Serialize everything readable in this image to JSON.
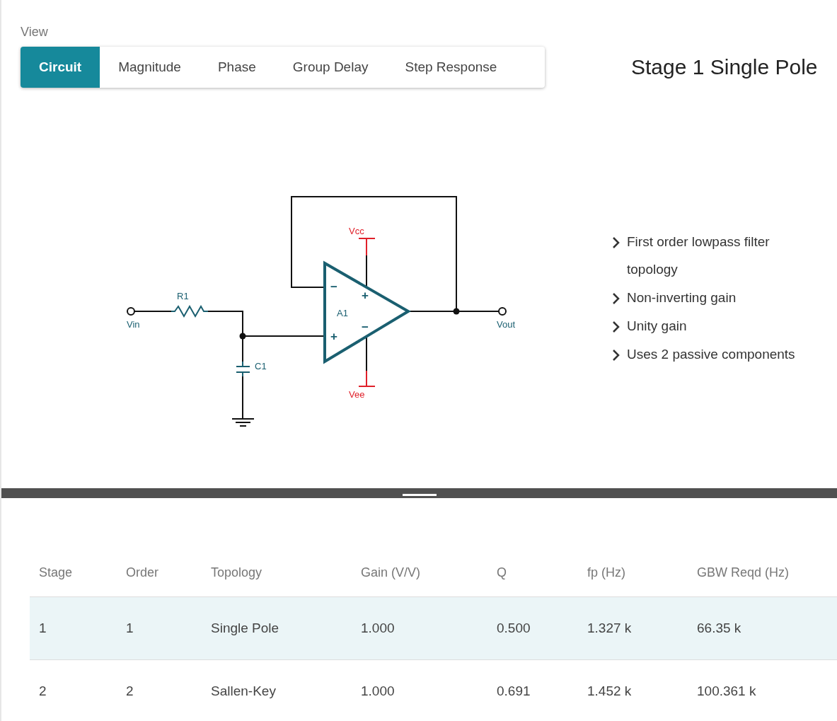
{
  "view_label": "View",
  "tabs": [
    {
      "label": "Circuit",
      "selected": true
    },
    {
      "label": "Magnitude",
      "selected": false
    },
    {
      "label": "Phase",
      "selected": false
    },
    {
      "label": "Group Delay",
      "selected": false
    },
    {
      "label": "Step Response",
      "selected": false
    }
  ],
  "circuit": {
    "input": "Vin",
    "output": "Vout",
    "resistor": "R1",
    "capacitor": "C1",
    "amplifier": "A1",
    "supply_positive": "Vcc",
    "supply_negative": "Vee",
    "input_signs": [
      "−",
      "+"
    ],
    "supply_signs": [
      "+",
      "−"
    ]
  },
  "stage_title": "Stage 1 Single Pole",
  "features": [
    "First order lowpass filter topology",
    "Non-inverting gain",
    "Unity gain",
    "Uses 2 passive components"
  ],
  "table": {
    "columns": [
      "Stage",
      "Order",
      "Topology",
      "Gain (V/V)",
      "Q",
      "fp (Hz)",
      "GBW Reqd (Hz)"
    ],
    "rows": [
      {
        "selected": true,
        "cells": [
          "1",
          "1",
          "Single Pole",
          "1.000",
          "0.500",
          "1.327 k",
          "66.35 k"
        ]
      },
      {
        "selected": false,
        "cells": [
          "2",
          "2",
          "Sallen-Key",
          "1.000",
          "0.691",
          "1.452 k",
          "100.361 k"
        ]
      }
    ]
  }
}
